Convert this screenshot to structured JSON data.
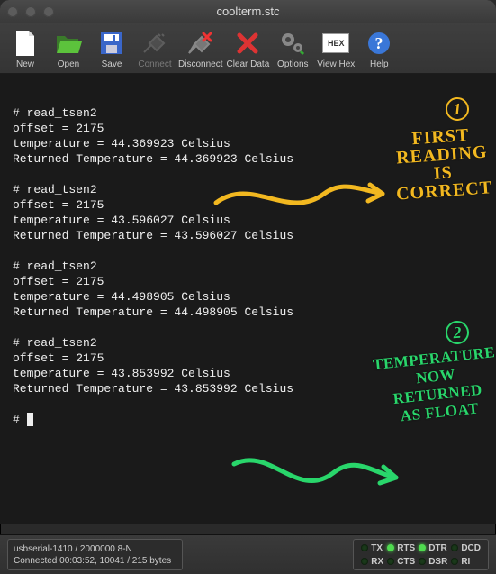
{
  "window": {
    "title": "coolterm.stc"
  },
  "toolbar": {
    "new": "New",
    "open": "Open",
    "save": "Save",
    "connect": "Connect",
    "disconnect": "Disconnect",
    "clear": "Clear Data",
    "options": "Options",
    "viewhex": "View Hex",
    "help": "Help",
    "hex_abbrev": "HEX"
  },
  "terminal": {
    "lines": [
      "",
      "# read_tsen2",
      "offset = 2175",
      "temperature = 44.369923 Celsius",
      "Returned Temperature = 44.369923 Celsius",
      "",
      "# read_tsen2",
      "offset = 2175",
      "temperature = 43.596027 Celsius",
      "Returned Temperature = 43.596027 Celsius",
      "",
      "# read_tsen2",
      "offset = 2175",
      "temperature = 44.498905 Celsius",
      "Returned Temperature = 44.498905 Celsius",
      "",
      "# read_tsen2",
      "offset = 2175",
      "temperature = 43.853992 Celsius",
      "Returned Temperature = 43.853992 Celsius",
      "",
      "# "
    ]
  },
  "status": {
    "port": "usbserial-1410 / 2000000 8-N",
    "conn": "Connected 00:03:52, 10041 / 215 bytes",
    "leds": {
      "tx": "TX",
      "rx": "RX",
      "rts": "RTS",
      "cts": "CTS",
      "dtr": "DTR",
      "dsr": "DSR",
      "dcd": "DCD",
      "ri": "RI"
    }
  },
  "annotations": {
    "one": "①",
    "one_text": "FIRST\nREADING\nIS\nCORRECT",
    "two": "②",
    "two_text": "TEMPERATURE\nNOW\nRETURNED\nAS FLOAT"
  },
  "colors": {
    "yellow": "#f2b820",
    "green": "#29d66b"
  }
}
